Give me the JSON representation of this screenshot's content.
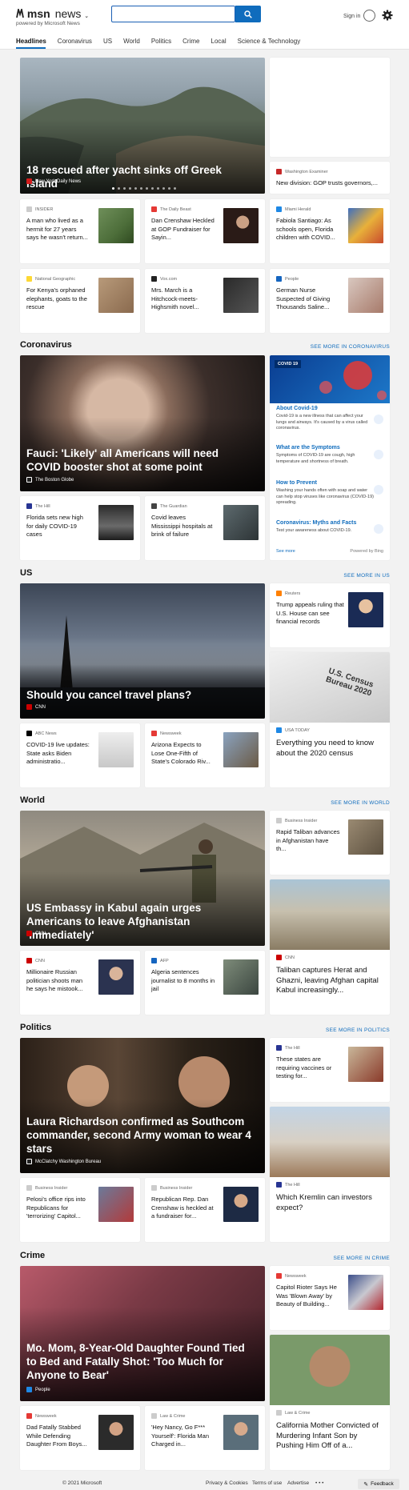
{
  "header": {
    "logo": "msn",
    "section": "news",
    "byline": "powered by Microsoft News",
    "search_placeholder": "",
    "sign_in": "Sign in"
  },
  "nav": [
    "Headlines",
    "Coronavirus",
    "US",
    "World",
    "Politics",
    "Crime",
    "Local",
    "Science & Technology"
  ],
  "headlines": {
    "hero": {
      "title": "18 rescued after yacht sinks off Greek island",
      "source": "New York Daily News"
    },
    "side": {
      "source": "Washington Examiner",
      "title": "New division: GOP trusts governors,..."
    },
    "cards": [
      {
        "source": "INSIDER",
        "title": "A man who lived as a hermit for 27 years says he wasn't return..."
      },
      {
        "source": "The Daily Beast",
        "title": "Dan Crenshaw Heckled at GOP Fundraiser for Sayin..."
      },
      {
        "source": "Miami Herald",
        "title": "Fabiola Santiago: As schools open, Florida children with COVID..."
      },
      {
        "source": "National Geographic",
        "title": "For Kenya's orphaned elephants, goats to the rescue"
      },
      {
        "source": "Vox.com",
        "title": "Mrs. March is a Hitchcock-meets-Highsmith novel..."
      },
      {
        "source": "People",
        "title": "German Nurse Suspected of Giving Thousands Saline..."
      }
    ]
  },
  "coronavirus": {
    "title": "Coronavirus",
    "see_more": "SEE MORE IN CORONAVIRUS",
    "hero": {
      "title": "Fauci: 'Likely' all Americans will need COVID booster shot at some point",
      "source": "The Boston Globe"
    },
    "cards": [
      {
        "source": "The Hill",
        "title": "Florida sets new high for daily COVID-19 cases"
      },
      {
        "source": "The Guardian",
        "title": "Covid leaves Mississippi hospitals at brink of failure"
      }
    ],
    "panel": {
      "badge": "COVID 19",
      "items": [
        {
          "heading": "About Covid-19",
          "desc": "Covid-19 is a new illness that can affect your lungs and airways. It's caused by a virus called coronavirus."
        },
        {
          "heading": "What are the Symptoms",
          "desc": "Symptoms of COVID-19 are cough, high temperature and shortness of breath."
        },
        {
          "heading": "How to Prevent",
          "desc": "Washing your hands often with soap and water can help stop viruses like coronavirus (COVID-19) spreading."
        },
        {
          "heading": "Coronavirus: Myths and Facts",
          "desc": "Test your awareness about COVID-19."
        }
      ],
      "see_more": "See more",
      "powered": "Powered by Bing"
    }
  },
  "us": {
    "title": "US",
    "see_more": "SEE MORE IN US",
    "hero": {
      "title": "Should you cancel travel plans?",
      "source": "CNN"
    },
    "side": {
      "source": "Reuters",
      "title": "Trump appeals ruling that U.S. House can see financial records"
    },
    "cards": [
      {
        "source": "ABC News",
        "title": "COVID-19 live updates: State asks Biden administratio..."
      },
      {
        "source": "Newsweek",
        "title": "Arizona Expects to Lose One-Fifth of State's Colorado Riv..."
      }
    ],
    "big": {
      "source": "USA TODAY",
      "title": "Everything you need to know about the 2020 census",
      "image_text": "U.S. Census Bureau 2020"
    }
  },
  "world": {
    "title": "World",
    "see_more": "SEE MORE IN WORLD",
    "hero": {
      "title": "US Embassy in Kabul again urges Americans to leave Afghanistan 'immediately'",
      "source": "CNN"
    },
    "side": {
      "source": "Business Insider",
      "title": "Rapid Taliban advances in Afghanistan have th..."
    },
    "cards": [
      {
        "source": "CNN",
        "title": "Millionaire Russian politician shoots man he says he mistook..."
      },
      {
        "source": "AFP",
        "title": "Algeria sentences journalist to 8 months in jail"
      }
    ],
    "big": {
      "source": "CNN",
      "title": "Taliban captures Herat and Ghazni, leaving Afghan capital Kabul increasingly..."
    }
  },
  "politics": {
    "title": "Politics",
    "see_more": "SEE MORE IN POLITICS",
    "hero": {
      "title": "Laura Richardson confirmed as Southcom commander, second Army woman to wear 4 stars",
      "source": "McClatchy Washington Bureau"
    },
    "side": {
      "source": "The Hill",
      "title": "These states are requiring vaccines or testing for..."
    },
    "cards": [
      {
        "source": "Business Insider",
        "title": "Pelosi's office rips into Republicans for 'terrorizing' Capitol..."
      },
      {
        "source": "Business Insider",
        "title": "Republican Rep. Dan Crenshaw is heckled at a fundraiser for..."
      }
    ],
    "big": {
      "source": "The Hill",
      "title": "Which Kremlin can investors expect?"
    }
  },
  "crime": {
    "title": "Crime",
    "see_more": "SEE MORE IN CRIME",
    "hero": {
      "title": "Mo. Mom, 8-Year-Old Daughter Found Tied to Bed and Fatally Shot: 'Too Much for Anyone to Bear'",
      "source": "People"
    },
    "side": {
      "source": "Newsweek",
      "title": "Capitol Rioter Says He Was 'Blown Away' by Beauty of Building..."
    },
    "cards": [
      {
        "source": "Newsweek",
        "title": "Dad Fatally Stabbed While Defending Daughter From Boys..."
      },
      {
        "source": "Law & Crime",
        "title": "'Hey Nancy, Go F*** Yourself': Florida Man Charged in..."
      }
    ],
    "big": {
      "source": "Law & Crime",
      "title": "California Mother Convicted of Murdering Infant Son by Pushing Him Off of a..."
    }
  },
  "footer": {
    "copyright": "© 2021 Microsoft",
    "privacy": "Privacy & Cookies",
    "terms": "Terms of use",
    "advertise": "Advertise",
    "more": "• • •",
    "feedback": "Feedback"
  },
  "colors": {
    "accent": "#0f6cbd",
    "background": "#f2f2f2"
  }
}
